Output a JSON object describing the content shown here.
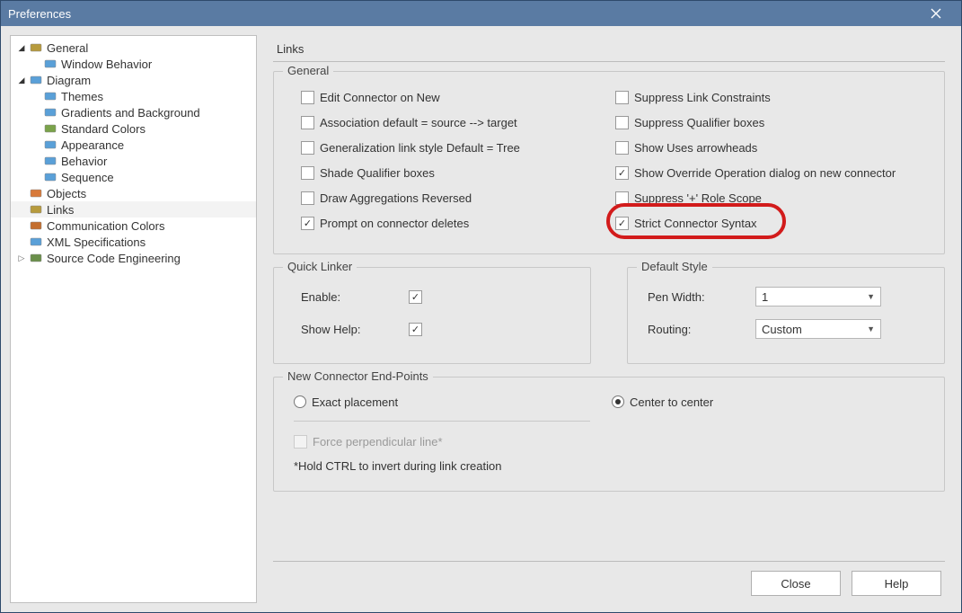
{
  "window": {
    "title": "Preferences"
  },
  "tree": [
    {
      "label": "General",
      "indent": 0,
      "toggle": "▼",
      "iconColor": "#b79b3d"
    },
    {
      "label": "Window Behavior",
      "indent": 1,
      "toggle": "",
      "iconColor": "#5aa0d8"
    },
    {
      "label": "Diagram",
      "indent": 0,
      "toggle": "▼",
      "iconColor": "#5aa0d8"
    },
    {
      "label": "Themes",
      "indent": 1,
      "toggle": "",
      "iconColor": "#5aa0d8"
    },
    {
      "label": "Gradients and Background",
      "indent": 1,
      "toggle": "",
      "iconColor": "#5aa0d8"
    },
    {
      "label": "Standard Colors",
      "indent": 1,
      "toggle": "",
      "iconColor": "#7aa34a"
    },
    {
      "label": "Appearance",
      "indent": 1,
      "toggle": "",
      "iconColor": "#5aa0d8"
    },
    {
      "label": "Behavior",
      "indent": 1,
      "toggle": "",
      "iconColor": "#5aa0d8"
    },
    {
      "label": "Sequence",
      "indent": 1,
      "toggle": "",
      "iconColor": "#5aa0d8"
    },
    {
      "label": "Objects",
      "indent": 0,
      "toggle": "",
      "iconColor": "#d87a3a"
    },
    {
      "label": "Links",
      "indent": 0,
      "toggle": "",
      "iconColor": "#b79b3d",
      "selected": true
    },
    {
      "label": "Communication Colors",
      "indent": 0,
      "toggle": "",
      "iconColor": "#c46e2e"
    },
    {
      "label": "XML Specifications",
      "indent": 0,
      "toggle": "",
      "iconColor": "#5aa0d8"
    },
    {
      "label": "Source Code Engineering",
      "indent": 0,
      "toggle": "▷",
      "iconColor": "#6a8f4a"
    }
  ],
  "page": {
    "title": "Links"
  },
  "general": {
    "title": "General",
    "left": [
      {
        "label": "Edit Connector on New",
        "checked": false
      },
      {
        "label": "Association default = source --> target",
        "checked": false
      },
      {
        "label": "Generalization link style Default = Tree",
        "checked": false
      },
      {
        "label": "Shade Qualifier boxes",
        "checked": false
      },
      {
        "label": "Draw Aggregations Reversed",
        "checked": false
      },
      {
        "label": "Prompt on connector deletes",
        "checked": true
      }
    ],
    "right": [
      {
        "label": "Suppress Link Constraints",
        "checked": false
      },
      {
        "label": "Suppress Qualifier boxes",
        "checked": false
      },
      {
        "label": "Show Uses arrowheads",
        "checked": false
      },
      {
        "label": "Show Override Operation dialog on new connector",
        "checked": true
      },
      {
        "label": "Suppress '+' Role Scope",
        "checked": false
      },
      {
        "label": "Strict Connector Syntax",
        "checked": true,
        "highlight": true
      }
    ]
  },
  "quickLinker": {
    "title": "Quick Linker",
    "rows": [
      {
        "label": "Enable:",
        "checked": true
      },
      {
        "label": "Show Help:",
        "checked": true
      }
    ]
  },
  "defaultStyle": {
    "title": "Default Style",
    "penWidthLabel": "Pen Width:",
    "penWidthValue": "1",
    "routingLabel": "Routing:",
    "routingValue": "Custom"
  },
  "newConnector": {
    "title": "New Connector End-Points",
    "exact": "Exact placement",
    "center": "Center to center",
    "force": "Force perpendicular line*",
    "note": "*Hold CTRL to invert during link creation"
  },
  "buttons": {
    "close": "Close",
    "help": "Help"
  }
}
